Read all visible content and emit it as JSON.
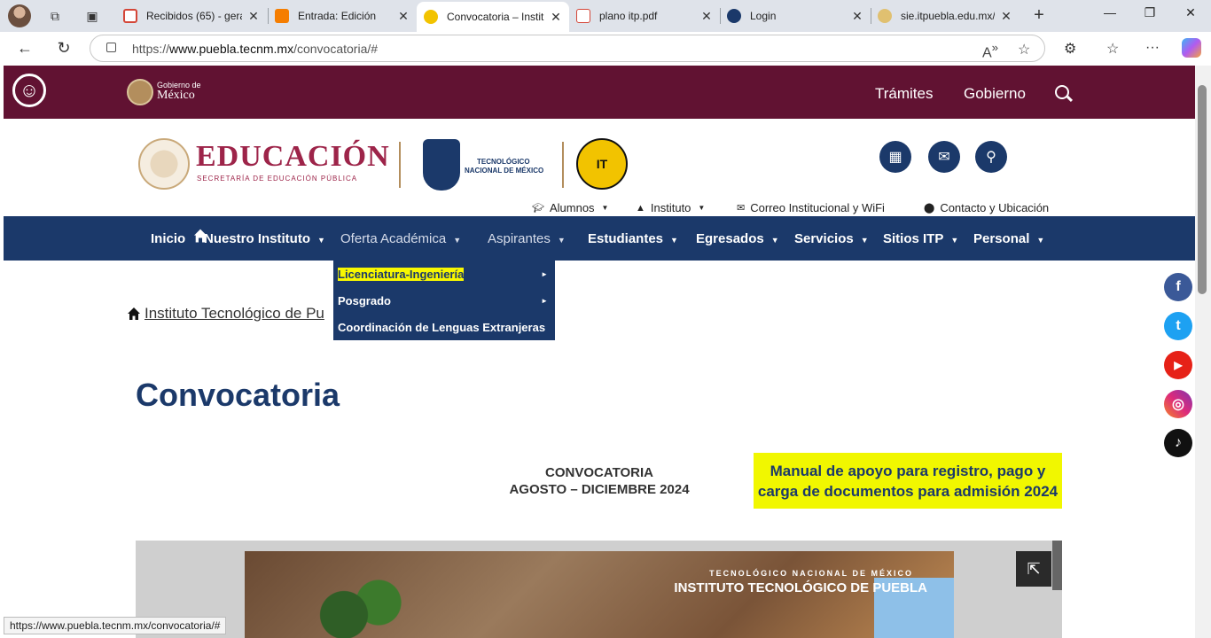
{
  "browser": {
    "tabs": [
      {
        "title": "Recibidos (65) - gera",
        "favicon_color": "#d44638"
      },
      {
        "title": "Entrada: Edición",
        "favicon_color": "#f57d00"
      },
      {
        "title": "Convocatoria – Instit",
        "favicon_color": "#f2c300",
        "active": true
      },
      {
        "title": "plano itp.pdf",
        "favicon_color": "#d44638"
      },
      {
        "title": "Login",
        "favicon_color": "#1b396a"
      },
      {
        "title": "sie.itpuebla.edu.mx/",
        "favicon_color": "#e0c070"
      }
    ],
    "url_prefix": "https://",
    "url_domain": "www.puebla.tecnm.mx",
    "url_path": "/convocatoria/#",
    "status_url": "https://www.puebla.tecnm.mx/convocatoria/#"
  },
  "gob_header": {
    "brand_small": "Gobierno de",
    "brand_main": "México",
    "links": [
      "Trámites",
      "Gobierno"
    ]
  },
  "logos": {
    "edu_title": "EDUCACIÓN",
    "edu_subtitle": "SECRETARÍA DE EDUCACIÓN PÚBLICA",
    "tecnm_line1": "TECNOLÓGICO",
    "tecnm_line2": "NACIONAL DE MÉXICO",
    "itp_mark": "IT"
  },
  "utility_nav": [
    {
      "label": "Alumnos",
      "icon": "graduation-cap-icon",
      "caret": true
    },
    {
      "label": "Instituto",
      "icon": "building-icon",
      "caret": true
    },
    {
      "label": "Correo Institucional y WiFi",
      "icon": "envelope-icon",
      "caret": false
    },
    {
      "label": "Contacto y Ubicación",
      "icon": "map-pin-icon",
      "caret": false
    }
  ],
  "main_nav": [
    {
      "label": "Inicio"
    },
    {
      "label": "Nuestro Instituto"
    },
    {
      "label": "Oferta Académica"
    },
    {
      "label": "Aspirantes"
    },
    {
      "label": "Estudiantes"
    },
    {
      "label": "Egresados"
    },
    {
      "label": "Servicios"
    },
    {
      "label": "Sitios ITP"
    },
    {
      "label": "Personal"
    }
  ],
  "dropdown": [
    {
      "label": "Licenciatura-Ingeniería",
      "highlighted": true,
      "submenu": true
    },
    {
      "label": "Posgrado",
      "submenu": true
    },
    {
      "label": "Coordinación de Lenguas Extranjeras",
      "submenu": false
    }
  ],
  "breadcrumb": {
    "text": "Instituto Tecnológico de Pu"
  },
  "page": {
    "title": "Convocatoria",
    "convocatoria_line1": "CONVOCATORIA",
    "convocatoria_line2": "AGOSTO – DICIEMBRE 2024",
    "manual_line1": "Manual de apoyo para registro, pago y",
    "manual_line2": "carga de documentos para admisión 2024",
    "viewer_line1": "TECNOLÓGICO NACIONAL DE MÉXICO",
    "viewer_line2": "INSTITUTO TECNOLÓGICO DE PUEBLA"
  },
  "social": [
    {
      "name": "facebook-icon",
      "color": "#3b5998",
      "glyph": "f"
    },
    {
      "name": "twitter-icon",
      "color": "#1da1f2",
      "glyph": "t"
    },
    {
      "name": "youtube-icon",
      "color": "#e62117",
      "glyph": "▶"
    },
    {
      "name": "instagram-icon",
      "color": "#c13584",
      "glyph": "◎"
    },
    {
      "name": "tiktok-icon",
      "color": "#111111",
      "glyph": "♪"
    }
  ],
  "colors": {
    "guinda": "#611232",
    "navy": "#1b396a",
    "highlight": "#f1f700"
  }
}
